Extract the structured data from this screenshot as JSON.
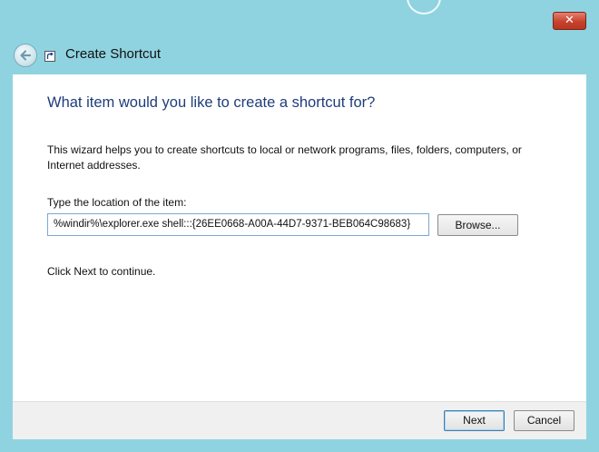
{
  "window": {
    "title": "Create Shortcut",
    "close_glyph": "✕"
  },
  "wizard": {
    "heading": "What item would you like to create a shortcut for?",
    "description": "This wizard helps you to create shortcuts to local or network programs, files, folders, computers, or Internet addresses.",
    "location_label": "Type the location of the item:",
    "location_value": "%windir%\\explorer.exe shell:::{26EE0668-A00A-44D7-9371-BEB064C98683}",
    "browse_label": "Browse...",
    "continue_text": "Click Next to continue."
  },
  "footer": {
    "next_label": "Next",
    "cancel_label": "Cancel"
  },
  "colors": {
    "titlebar": "#8fd3e0",
    "heading": "#1f3d7a",
    "close_button": "#c7432e"
  },
  "icons": {
    "back": "back-arrow-icon",
    "shortcut": "shortcut-arrow-icon",
    "close": "close-icon"
  }
}
